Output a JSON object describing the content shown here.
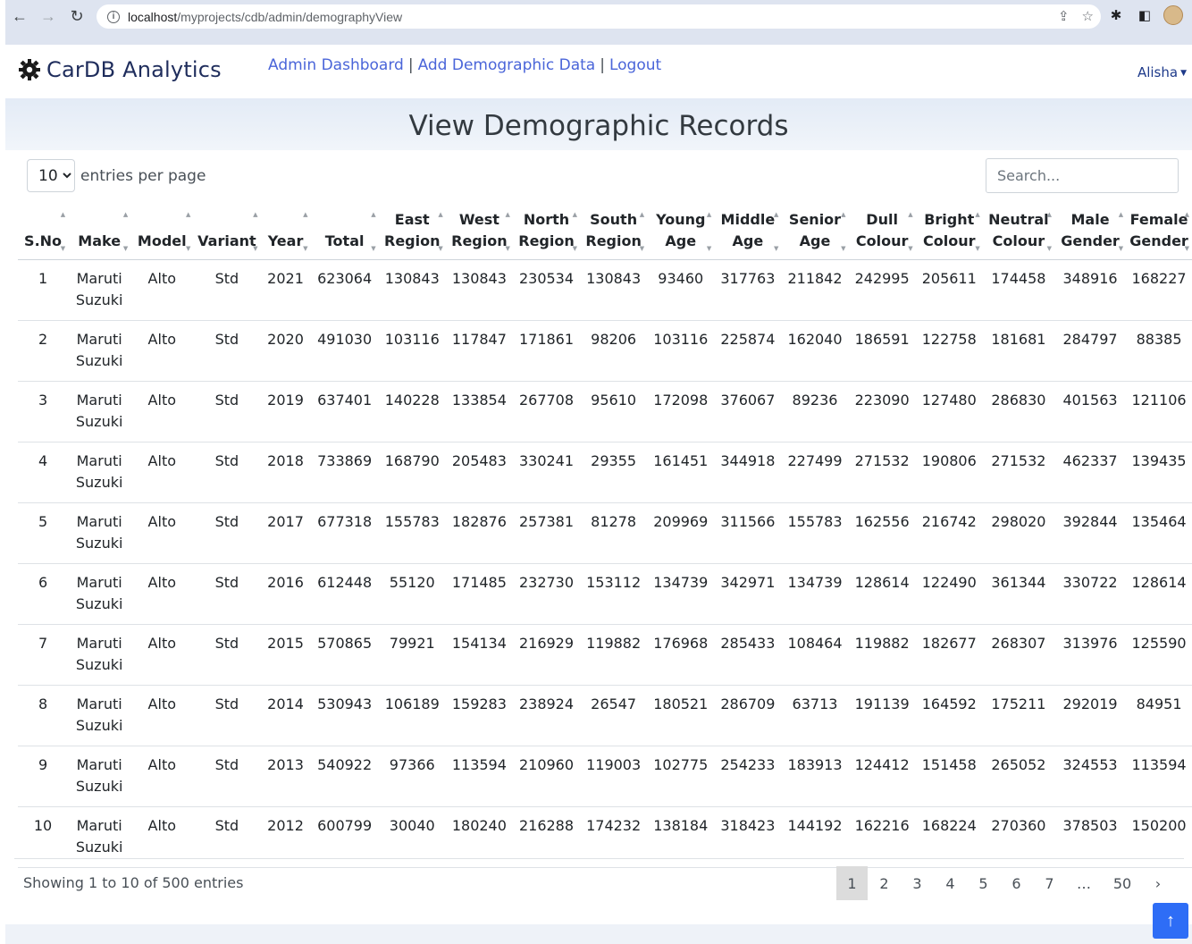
{
  "browser": {
    "url_host": "localhost",
    "url_path": "/myprojects/cdb/admin/demographyView"
  },
  "nav": {
    "brand": "CarDB Analytics",
    "links": [
      "Admin Dashboard",
      "Add Demographic Data",
      "Logout"
    ],
    "separator": "|",
    "user": "Alisha"
  },
  "page": {
    "title": "View Demographic Records"
  },
  "controls": {
    "per_page_value": "10",
    "per_page_label": "entries per page",
    "search_placeholder": "Search..."
  },
  "table": {
    "headers": [
      [
        "S.No"
      ],
      [
        "Make"
      ],
      [
        "Model"
      ],
      [
        "Variant"
      ],
      [
        "Year"
      ],
      [
        "Total"
      ],
      [
        "East",
        "Region"
      ],
      [
        "West",
        "Region"
      ],
      [
        "North",
        "Region"
      ],
      [
        "South",
        "Region"
      ],
      [
        "Young",
        "Age"
      ],
      [
        "Middle",
        "Age"
      ],
      [
        "Senior",
        "Age"
      ],
      [
        "Dull",
        "Colour"
      ],
      [
        "Bright",
        "Colour"
      ],
      [
        "Neutral",
        "Colour"
      ],
      [
        "Male",
        "Gender"
      ],
      [
        "Female",
        "Gender"
      ]
    ],
    "rows": [
      [
        "1",
        "Maruti Suzuki",
        "Alto",
        "Std",
        "2021",
        "623064",
        "130843",
        "130843",
        "230534",
        "130843",
        "93460",
        "317763",
        "211842",
        "242995",
        "205611",
        "174458",
        "348916",
        "168227"
      ],
      [
        "2",
        "Maruti Suzuki",
        "Alto",
        "Std",
        "2020",
        "491030",
        "103116",
        "117847",
        "171861",
        "98206",
        "103116",
        "225874",
        "162040",
        "186591",
        "122758",
        "181681",
        "284797",
        "88385"
      ],
      [
        "3",
        "Maruti Suzuki",
        "Alto",
        "Std",
        "2019",
        "637401",
        "140228",
        "133854",
        "267708",
        "95610",
        "172098",
        "376067",
        "89236",
        "223090",
        "127480",
        "286830",
        "401563",
        "121106"
      ],
      [
        "4",
        "Maruti Suzuki",
        "Alto",
        "Std",
        "2018",
        "733869",
        "168790",
        "205483",
        "330241",
        "29355",
        "161451",
        "344918",
        "227499",
        "271532",
        "190806",
        "271532",
        "462337",
        "139435"
      ],
      [
        "5",
        "Maruti Suzuki",
        "Alto",
        "Std",
        "2017",
        "677318",
        "155783",
        "182876",
        "257381",
        "81278",
        "209969",
        "311566",
        "155783",
        "162556",
        "216742",
        "298020",
        "392844",
        "135464"
      ],
      [
        "6",
        "Maruti Suzuki",
        "Alto",
        "Std",
        "2016",
        "612448",
        "55120",
        "171485",
        "232730",
        "153112",
        "134739",
        "342971",
        "134739",
        "128614",
        "122490",
        "361344",
        "330722",
        "128614"
      ],
      [
        "7",
        "Maruti Suzuki",
        "Alto",
        "Std",
        "2015",
        "570865",
        "79921",
        "154134",
        "216929",
        "119882",
        "176968",
        "285433",
        "108464",
        "119882",
        "182677",
        "268307",
        "313976",
        "125590"
      ],
      [
        "8",
        "Maruti Suzuki",
        "Alto",
        "Std",
        "2014",
        "530943",
        "106189",
        "159283",
        "238924",
        "26547",
        "180521",
        "286709",
        "63713",
        "191139",
        "164592",
        "175211",
        "292019",
        "84951"
      ],
      [
        "9",
        "Maruti Suzuki",
        "Alto",
        "Std",
        "2013",
        "540922",
        "97366",
        "113594",
        "210960",
        "119003",
        "102775",
        "254233",
        "183913",
        "124412",
        "151458",
        "265052",
        "324553",
        "113594"
      ],
      [
        "10",
        "Maruti Suzuki",
        "Alto",
        "Std",
        "2012",
        "600799",
        "30040",
        "180240",
        "216288",
        "174232",
        "138184",
        "318423",
        "144192",
        "162216",
        "168224",
        "270360",
        "378503",
        "150200"
      ]
    ]
  },
  "footer": {
    "showing": "Showing 1 to 10 of 500 entries",
    "pages": [
      "1",
      "2",
      "3",
      "4",
      "5",
      "6",
      "7",
      "…",
      "50",
      "›"
    ],
    "active_page": "1"
  },
  "colors": {
    "link": "#4a65d9",
    "brand": "#1f2d5c",
    "accent_button": "#2e6df6"
  }
}
